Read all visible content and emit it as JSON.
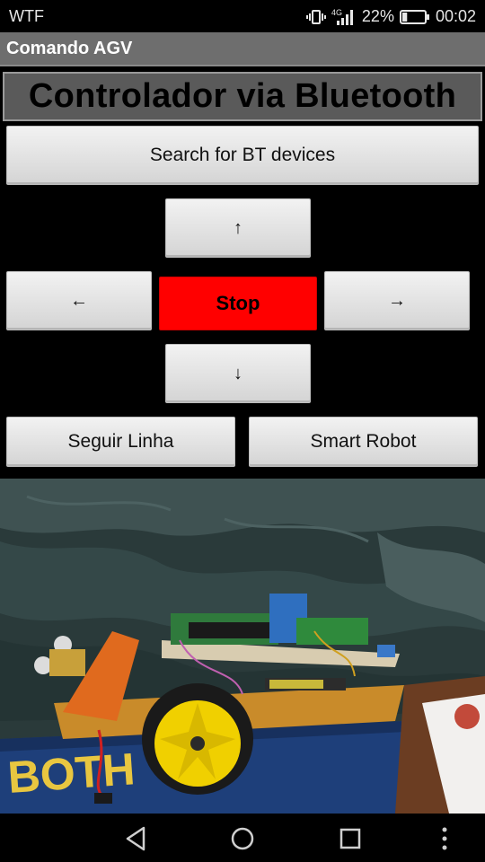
{
  "status_bar": {
    "carrier": "WTF",
    "network": "4G",
    "battery": "22%",
    "battery_level": 0.22,
    "time": "00:02"
  },
  "app_bar": {
    "title": "Comando AGV"
  },
  "heading": "Controlador via Bluetooth",
  "buttons": {
    "search": "Search for BT devices",
    "up": "↑",
    "left": "←",
    "stop": "Stop",
    "right": "→",
    "down": "↓",
    "seguir": "Seguir Linha",
    "smart": "Smart Robot"
  },
  "colors": {
    "stop_button": "#ff0000",
    "app_bar": "#6e6e6e",
    "heading_box": "#5a5a5a"
  },
  "photo": {
    "wheel_text": "BOTH"
  },
  "navigation": [
    "back-icon",
    "home-icon",
    "recents-icon",
    "overflow-menu-icon"
  ]
}
